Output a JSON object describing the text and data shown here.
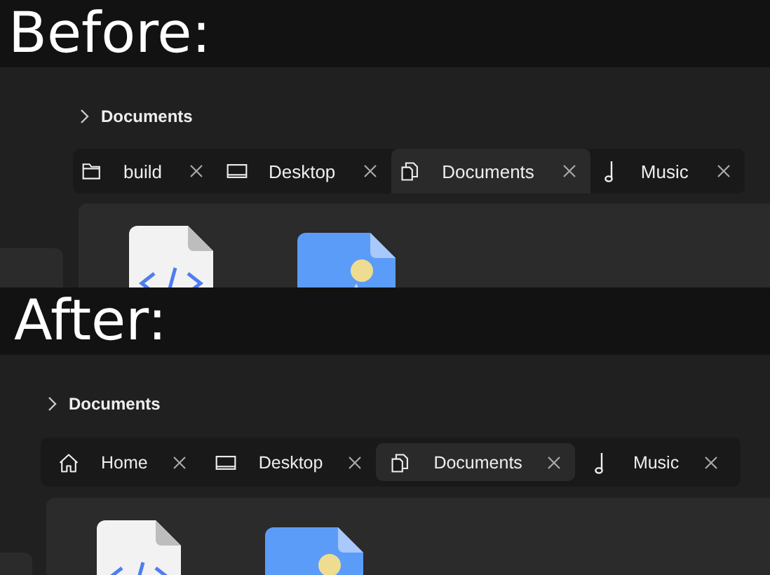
{
  "comparisons": [
    {
      "caption": "Before:",
      "breadcrumb": "Documents",
      "tabs": [
        {
          "label": "build",
          "kind": "folder",
          "selected": false
        },
        {
          "label": "Desktop",
          "kind": "laptop",
          "selected": false
        },
        {
          "label": "Documents",
          "kind": "documents",
          "selected": true
        },
        {
          "label": "Music",
          "kind": "music",
          "selected": false
        }
      ],
      "files": [
        {
          "kind": "code"
        },
        {
          "kind": "image"
        }
      ]
    },
    {
      "caption": "After:",
      "breadcrumb": "Documents",
      "tabs": [
        {
          "label": "Home",
          "kind": "home",
          "selected": false
        },
        {
          "label": "Desktop",
          "kind": "laptop",
          "selected": false
        },
        {
          "label": "Documents",
          "kind": "documents",
          "selected": true
        },
        {
          "label": "Music",
          "kind": "music",
          "selected": false
        }
      ],
      "files": [
        {
          "kind": "code"
        },
        {
          "kind": "image"
        }
      ]
    }
  ]
}
